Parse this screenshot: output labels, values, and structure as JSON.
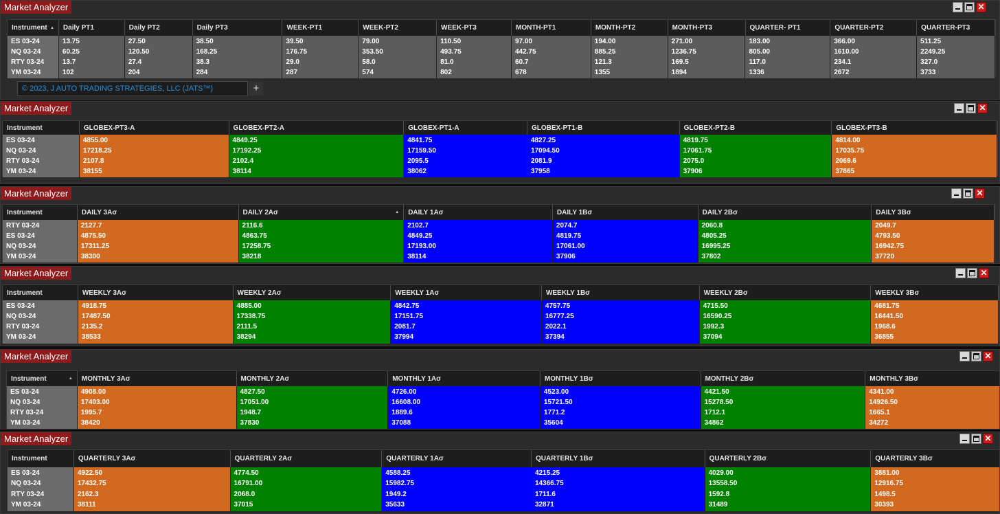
{
  "window_title": "Market Analyzer",
  "icons": {
    "minimize": "minimize-icon",
    "maximize": "maximize-icon",
    "close": "close-icon",
    "sort": "sort-ascending-icon",
    "add_tab": "plus-icon"
  },
  "colors": {
    "orange": "#d2691e",
    "green": "#008200",
    "blue": "#0000ff",
    "title_bar": "#8e1a1c",
    "copyright": "#2a8fd8"
  },
  "panels": [
    {
      "title": "Market Analyzer",
      "columns": [
        "Instrument",
        "Daily PT1",
        "Daily PT2",
        "Daily PT3",
        "WEEK-PT1",
        "WEEK-PT2",
        "WEEK-PT3",
        "MONTH-PT1",
        "MONTH-PT2",
        "MONTH-PT3",
        "QUARTER- PT1",
        "QUARTER-PT2",
        "QUARTER-PT3"
      ],
      "rows": [
        [
          "ES 03-24",
          "13.75",
          "27.50",
          "38.50",
          "39.50",
          "79.00",
          "110.50",
          "97.00",
          "194.00",
          "271.00",
          "183.00",
          "366.00",
          "511.25"
        ],
        [
          "NQ 03-24",
          "60.25",
          "120.50",
          "168.25",
          "176.75",
          "353.50",
          "493.75",
          "442.75",
          "885.25",
          "1236.75",
          "805.00",
          "1610.00",
          "2249.25"
        ],
        [
          "RTY 03-24",
          "13.7",
          "27.4",
          "38.3",
          "29.0",
          "58.0",
          "81.0",
          "60.7",
          "121.3",
          "169.5",
          "117.0",
          "234.1",
          "327.0"
        ],
        [
          "YM 03-24",
          "102",
          "204",
          "284",
          "287",
          "574",
          "802",
          "678",
          "1355",
          "1894",
          "1336",
          "2672",
          "3733"
        ]
      ],
      "tab_label": "© 2023, J AUTO TRADING STRATEGIES, LLC (JATS™)",
      "add_tab_label": "+"
    },
    {
      "title": "Market Analyzer",
      "columns": [
        "Instrument",
        "GLOBEX-PT3-A",
        "GLOBEX-PT2-A",
        "GLOBEX-PT1-A",
        "GLOBEX-PT1-B",
        "GLOBEX-PT2-B",
        "GLOBEX-PT3-B"
      ],
      "rows": [
        [
          "ES 03-24",
          "4855.00",
          "4849.25",
          "4841.75",
          "4827.25",
          "4819.75",
          "4814.00"
        ],
        [
          "NQ 03-24",
          "17218.25",
          "17192.25",
          "17159.50",
          "17094.50",
          "17061.75",
          "17035.75"
        ],
        [
          "RTY 03-24",
          "2107.8",
          "2102.4",
          "2095.5",
          "2081.9",
          "2075.0",
          "2069.6"
        ],
        [
          "YM 03-24",
          "38155",
          "38114",
          "38062",
          "37958",
          "37906",
          "37865"
        ]
      ]
    },
    {
      "title": "Market Analyzer",
      "columns": [
        "Instrument",
        "DAILY 3Aσ",
        "DAILY 2Aσ",
        "DAILY 1Aσ",
        "DAILY 1Bσ",
        "DAILY 2Bσ",
        "DAILY 3Bσ"
      ],
      "rows": [
        [
          "RTY 03-24",
          "2127.7",
          "2116.6",
          "2102.7",
          "2074.7",
          "2060.8",
          "2049.7"
        ],
        [
          "ES 03-24",
          "4875.50",
          "4863.75",
          "4849.25",
          "4819.75",
          "4805.25",
          "4793.50"
        ],
        [
          "NQ 03-24",
          "17311.25",
          "17258.75",
          "17193.00",
          "17061.00",
          "16995.25",
          "16942.75"
        ],
        [
          "YM 03-24",
          "38300",
          "38218",
          "38114",
          "37906",
          "37802",
          "37720"
        ]
      ]
    },
    {
      "title": "Market Analyzer",
      "columns": [
        "Instrument",
        "WEEKLY 3Aσ",
        "WEEKLY 2Aσ",
        "WEEKLY 1Aσ",
        "WEEKLY 1Bσ",
        "WEEKLY 2Bσ",
        "WEEKLY 3Bσ"
      ],
      "rows": [
        [
          "ES 03-24",
          "4918.75",
          "4885.00",
          "4842.75",
          "4757.75",
          "4715.50",
          "4681.75"
        ],
        [
          "NQ 03-24",
          "17487.50",
          "17338.75",
          "17151.75",
          "16777.25",
          "16590.25",
          "16441.50"
        ],
        [
          "RTY 03-24",
          "2135.2",
          "2111.5",
          "2081.7",
          "2022.1",
          "1992.3",
          "1968.6"
        ],
        [
          "YM 03-24",
          "38533",
          "38294",
          "37994",
          "37394",
          "37094",
          "36855"
        ]
      ]
    },
    {
      "title": "Market Analyzer",
      "columns": [
        "Instrument",
        "MONTHLY 3Aσ",
        "MONTHLY 2Aσ",
        "MONTHLY 1Aσ",
        "MONTHLY 1Bσ",
        "MONTHLY 2Bσ",
        "MONTHLY 3Bσ"
      ],
      "rows": [
        [
          "ES 03-24",
          "4908.00",
          "4827.50",
          "4726.00",
          "4523.00",
          "4421.50",
          "4341.00"
        ],
        [
          "NQ 03-24",
          "17403.00",
          "17051.00",
          "16608.00",
          "15721.50",
          "15278.50",
          "14926.50"
        ],
        [
          "RTY 03-24",
          "1995.7",
          "1948.7",
          "1889.6",
          "1771.2",
          "1712.1",
          "1665.1"
        ],
        [
          "YM 03-24",
          "38420",
          "37830",
          "37088",
          "35604",
          "34862",
          "34272"
        ]
      ]
    },
    {
      "title": "Market Analyzer",
      "columns": [
        "Instrument",
        "QUARTERLY 3Aσ",
        "QUARTERLY 2Aσ",
        "QUARTERLY 1Aσ",
        "QUARTERLY 1Bσ",
        "QUARTERLY 2Bσ",
        "QUARTERLY 3Bσ"
      ],
      "rows": [
        [
          "ES 03-24",
          "4922.50",
          "4774.50",
          "4588.25",
          "4215.25",
          "4029.00",
          "3881.00"
        ],
        [
          "NQ 03-24",
          "17432.75",
          "16791.00",
          "15982.75",
          "14366.75",
          "13558.50",
          "12916.75"
        ],
        [
          "RTY 03-24",
          "2162.3",
          "2068.0",
          "1949.2",
          "1711.6",
          "1592.8",
          "1498.5"
        ],
        [
          "YM 03-24",
          "38111",
          "37015",
          "35633",
          "32871",
          "31489",
          "30393"
        ]
      ]
    }
  ]
}
